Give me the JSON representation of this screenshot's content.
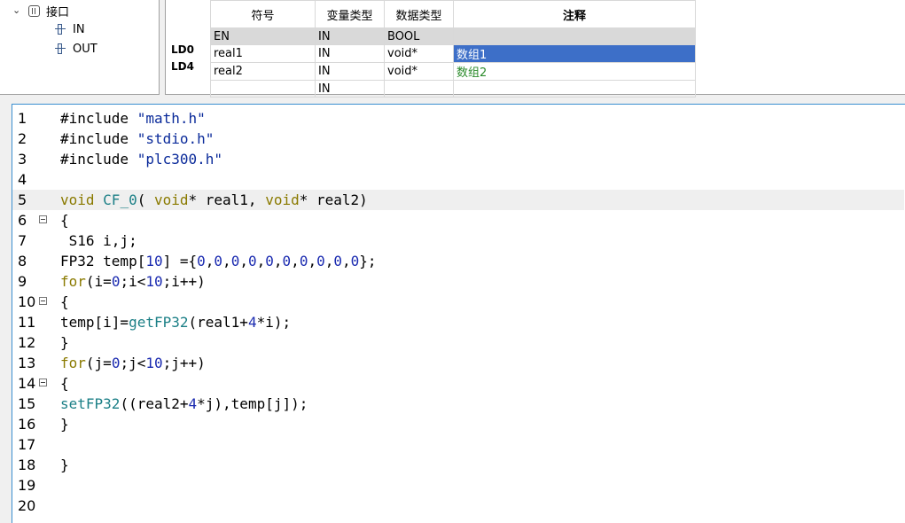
{
  "tree": {
    "root": "接口",
    "children": [
      "IN",
      "OUT"
    ]
  },
  "var_table": {
    "row_labels": [
      "LD0",
      "LD4"
    ],
    "headers": [
      "符号",
      "变量类型",
      "数据类型",
      "注释"
    ],
    "rows": [
      {
        "symbol": "EN",
        "var_type": "IN",
        "data_type": "BOOL",
        "comment": ""
      },
      {
        "symbol": "real1",
        "var_type": "IN",
        "data_type": "void*",
        "comment": "数组1"
      },
      {
        "symbol": "real2",
        "var_type": "IN",
        "data_type": "void*",
        "comment": "数组2"
      },
      {
        "symbol": "",
        "var_type": "IN",
        "data_type": "",
        "comment": ""
      }
    ]
  },
  "editor": {
    "line_numbers": [
      "1",
      "2",
      "3",
      "4",
      "5",
      "6",
      "7",
      "8",
      "9",
      "10",
      "11",
      "12",
      "13",
      "14",
      "15",
      "16",
      "17",
      "18",
      "19",
      "20"
    ],
    "lines": [
      "#include \"math.h\"",
      "#include \"stdio.h\"",
      "#include \"plc300.h\"",
      "",
      "void CF_0( void* real1, void* real2)",
      "{",
      " S16 i,j;",
      "FP32 temp[10] ={0,0,0,0,0,0,0,0,0,0};",
      "for(i=0;i<10;i++)",
      "{",
      "temp[i]=getFP32(real1+4*i);",
      "}",
      "for(j=0;j<10;j++)",
      "{",
      "setFP32((real2+4*j),temp[j]);",
      "}",
      "",
      "}",
      "",
      ""
    ]
  }
}
